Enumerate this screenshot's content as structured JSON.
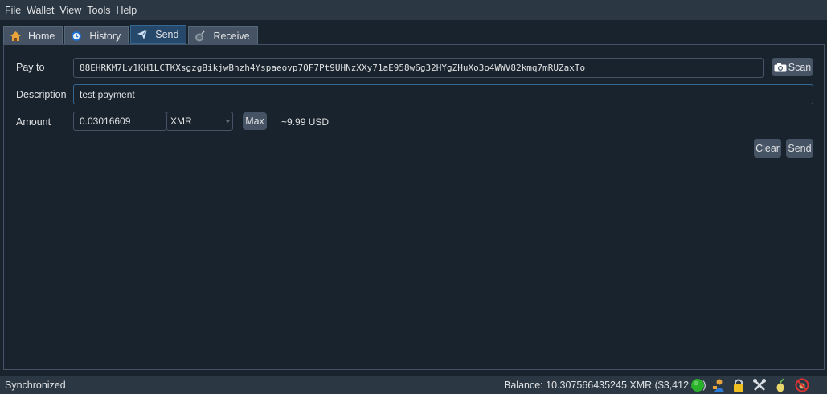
{
  "menubar": {
    "items": [
      "File",
      "Wallet",
      "View",
      "Tools",
      "Help"
    ]
  },
  "tabs": [
    {
      "label": "Home",
      "icon": "home-icon"
    },
    {
      "label": "History",
      "icon": "history-icon"
    },
    {
      "label": "Send",
      "icon": "send-icon",
      "active": true
    },
    {
      "label": "Receive",
      "icon": "receive-icon"
    }
  ],
  "send_form": {
    "pay_to_label": "Pay to",
    "pay_to_value": "88EHRKM7Lv1KH1LCTKXsgzgBikjwBhzh4Yspaeovp7QF7Pt9UHNzXXy71aE958w6g32HYgZHuXo3o4WWV82kmq7mRUZaxTo",
    "scan_button": "Scan",
    "description_label": "Description",
    "description_value": "test payment",
    "amount_label": "Amount",
    "amount_value": "0.03016609",
    "currency_selected": "XMR",
    "max_button": "Max",
    "fiat_estimate": "~9.99 USD",
    "clear_button": "Clear",
    "send_button": "Send"
  },
  "statusbar": {
    "sync_status": "Synchronized",
    "balance": "Balance: 10.307566435245 XMR ($3,412.01)",
    "icons": [
      "status-connected-icon",
      "account-icon",
      "lock-icon",
      "tools-icon",
      "seed-icon",
      "network-icon"
    ]
  },
  "colors": {
    "background": "#19232d",
    "bar": "#2b3843",
    "accent": "#346792",
    "connected": "#2bb02b"
  }
}
